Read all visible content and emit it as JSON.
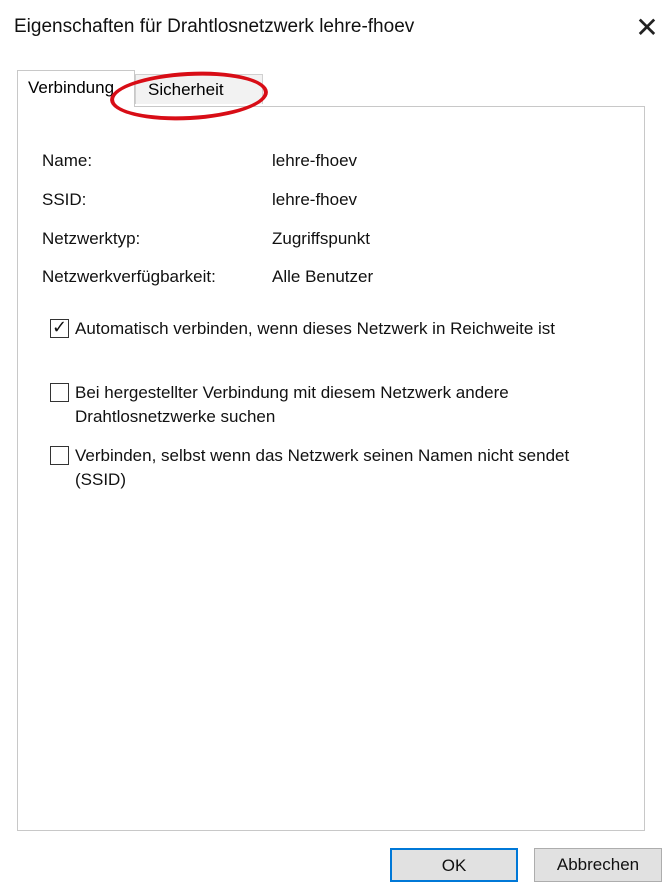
{
  "window": {
    "title": "Eigenschaften für Drahtlosnetzwerk lehre-fhoev",
    "close_glyph": "✕"
  },
  "tabs": [
    {
      "label": "Verbindung",
      "active": true
    },
    {
      "label": "Sicherheit",
      "active": false
    }
  ],
  "annotation": {
    "ring_color": "#d80d16"
  },
  "properties": [
    {
      "label": "Name:",
      "value": "lehre-fhoev"
    },
    {
      "label": "SSID:",
      "value": "lehre-fhoev"
    },
    {
      "label": "Netzwerktyp:",
      "value": "Zugriffspunkt"
    },
    {
      "label": "Netzwerkverfügbarkeit:",
      "value": "Alle Benutzer"
    }
  ],
  "options": [
    {
      "label": "Automatisch verbinden, wenn dieses Netzwerk in Reichweite ist",
      "checked": true
    },
    {
      "label": "Bei hergestellter Verbindung mit diesem Netzwerk andere Drahtlosnetzwerke suchen",
      "checked": false
    },
    {
      "label": "Verbinden, selbst wenn das Netzwerk seinen Namen nicht sendet (SSID)",
      "checked": false
    }
  ],
  "buttons": {
    "ok_label": "OK",
    "cancel_label": "Abbrechen"
  },
  "colors": {
    "accent": "#0078d7",
    "highlight": "#d80d16"
  }
}
